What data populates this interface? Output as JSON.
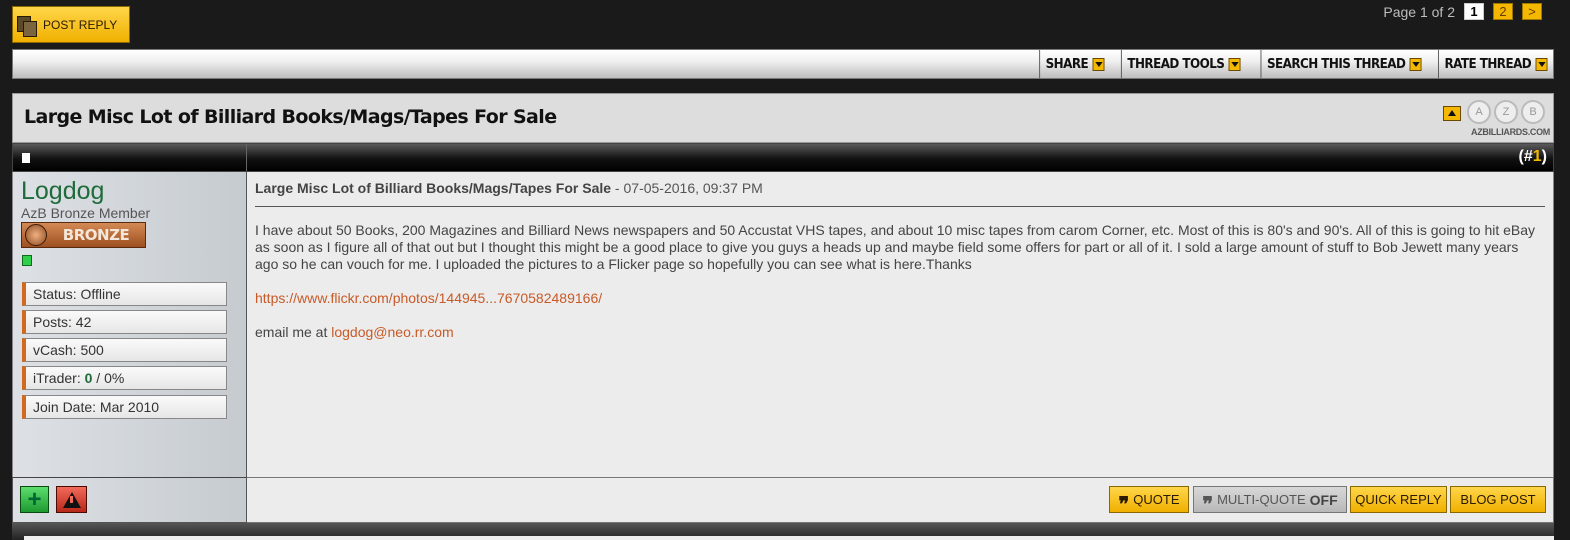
{
  "top": {
    "post_reply_label": "POST REPLY",
    "page_label": "Page 1 of 2",
    "pages": [
      "1",
      "2"
    ],
    "next_label": ">"
  },
  "toolbar": {
    "share": "SHARE",
    "thread_tools": "THREAD TOOLS",
    "search_thread": "SEARCH THIS THREAD",
    "rate_thread": "RATE THREAD"
  },
  "thread": {
    "title": "Large Misc Lot of Billiard Books/Mags/Tapes For Sale",
    "logo_letters": [
      "A",
      "Z",
      "B"
    ],
    "logo_text": "AZBILLIARDS.COM"
  },
  "post": {
    "number_prefix": "(#",
    "number": "1",
    "number_suffix": ")",
    "title": "Large Misc Lot of Billiard Books/Mags/Tapes For Sale",
    "date_sep": " - ",
    "date": "07-05-2016, 09:37 PM",
    "body": "I have about 50 Books, 200 Magazines and Billiard News newspapers and 50 Accustat VHS tapes, and about 10 misc tapes from carom Corner, etc. Most of this is 80's and 90's. All of this is going to hit eBay as soon as I figure all of that out but I thought this might be a good place to give you guys a heads up and maybe field some offers for part or all of it. I sold a large amount of stuff to Bob Jewett many years ago so he can vouch for me. I uploaded the pictures to a Flicker page so hopefully you can see what is here.Thanks",
    "link": "https://www.flickr.com/photos/144945...7670582489166/",
    "email_prefix": "email me at ",
    "email": "logdog@neo.rr.com"
  },
  "user": {
    "name": "Logdog",
    "title": "AzB Bronze Member",
    "rank": "BRONZE",
    "status": "Status: Offline",
    "posts": "Posts: 42",
    "vcash": "vCash: 500",
    "itrader_label": "iTrader: ",
    "itrader_count": "0",
    "itrader_pct": " / 0%",
    "join_date": "Join Date: Mar 2010"
  },
  "footer": {
    "quote": "QUOTE",
    "multiquote": "MULTI-QUOTE",
    "multiquote_state": "OFF",
    "quick_reply": "QUICK REPLY",
    "blog_post": "BLOG POST"
  },
  "colors": {
    "accent_yellow": "#f5b800",
    "username_green": "#1f6b3a",
    "link_orange": "#c85a28",
    "bronze": "#b86a38"
  },
  "icons": [
    "post-reply-icon",
    "dropdown-arrow-icon",
    "collapse-icon",
    "post-doc-icon",
    "online-status-icon",
    "add-icon",
    "warning-icon",
    "quote-icon",
    "multiquote-icon"
  ]
}
